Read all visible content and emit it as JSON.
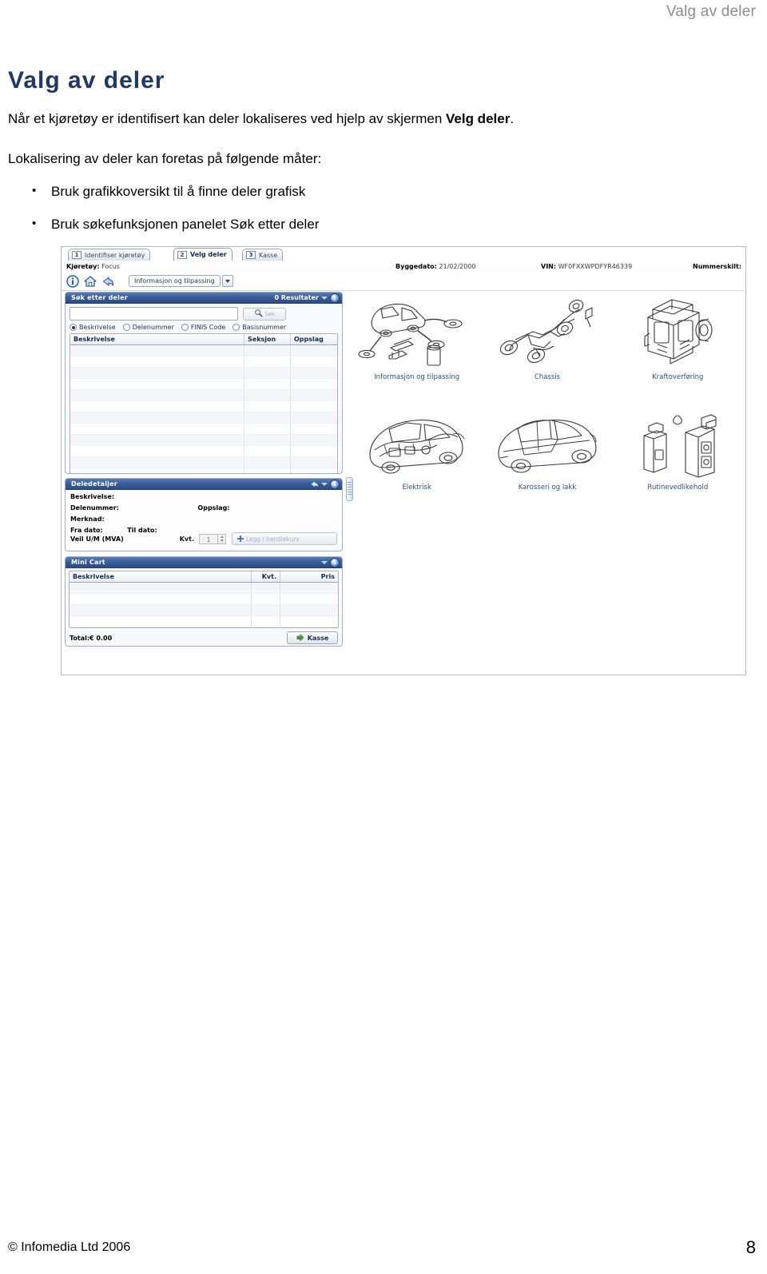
{
  "document": {
    "running_header": "Valg av deler",
    "title": "Valg av deler",
    "paragraph_1_pre": "Når et kjøretøy er identifisert kan deler lokaliseres ved hjelp av skjermen ",
    "paragraph_1_bold": "Velg deler",
    "paragraph_1_post": ".",
    "paragraph_2": "Lokalisering av deler kan foretas på følgende måter:",
    "bullets": [
      "Bruk grafikkoversikt til å finne deler grafisk",
      "Bruk søkefunksjonen panelet Søk etter deler"
    ],
    "bullet_glyph": "•",
    "footer_copyright": "© Infomedia Ltd 2006",
    "footer_page_number": "8",
    "title_color": "#1F3864",
    "header_color": "#8D8D8D"
  },
  "app": {
    "tabs": [
      {
        "number": "1",
        "label": "Identifiser kjøretøy",
        "active": false
      },
      {
        "number": "2",
        "label": "Velg deler",
        "active": true
      },
      {
        "number": "3",
        "label": "Kasse",
        "active": false
      }
    ],
    "vehicle_bar": {
      "vehicle_label": "Kjøretøy:",
      "vehicle_value": "Focus",
      "built_label": "Byggedato:",
      "built_value": "21/02/2000",
      "vin_label": "VIN:",
      "vin_value": "WF0FXXWPDFYR46339",
      "plate_label": "Nummerskilt:",
      "plate_value": ""
    },
    "toolbar": {
      "info_icon": "info-icon",
      "home_icon": "home-icon",
      "back_icon": "back-arrow-icon",
      "section_select_value": "Informasjon og tilpassing",
      "dropdown_icon": "chevron-down-icon"
    },
    "search_panel": {
      "title": "Søk etter deler",
      "results_count": "0 Resultater",
      "collapse_icon": "chevron-down-icon",
      "info_icon": "info-icon",
      "query_value": "",
      "query_placeholder": "",
      "search_button_label": "Søk",
      "search_icon": "magnifier-icon",
      "radio_options": [
        {
          "label": "Beskrivelse",
          "selected": true
        },
        {
          "label": "Delenummer",
          "selected": false
        },
        {
          "label": "FINIS Code",
          "selected": false
        },
        {
          "label": "Basisnummer",
          "selected": false
        }
      ],
      "columns": [
        "Beskrivelse",
        "Seksjon",
        "Oppslag"
      ],
      "rows": []
    },
    "detail_panel": {
      "title": "Deledetaljer",
      "back_icon": "back-arrow-icon",
      "collapse_icon": "chevron-down-icon",
      "info_icon": "info-icon",
      "fields": [
        {
          "label": "Beskrivelse:",
          "value": ""
        },
        {
          "label": "Delenummer:",
          "value": ""
        },
        {
          "label": "Oppslag:",
          "value": ""
        },
        {
          "label": "Merknad:",
          "value": ""
        },
        {
          "label": "Fra dato:",
          "value": ""
        },
        {
          "label": "Til dato:",
          "value": ""
        }
      ],
      "price_label": "Veil U/M (MVA)",
      "price_value": "",
      "qty_label": "Kvt.",
      "qty_value": "1",
      "add_to_cart_label": "Legg i handlekurv",
      "add_icon": "plus-icon"
    },
    "cart_panel": {
      "title": "Mini Cart",
      "collapse_icon": "chevron-down-icon",
      "info_icon": "info-icon",
      "columns": [
        "Beskrivelse",
        "Kvt.",
        "Pris"
      ],
      "rows": [],
      "total_label": "Total:€ 0.00",
      "checkout_label": "Kasse",
      "checkout_icon": "arrow-right-icon"
    },
    "graphics": [
      {
        "label": "Informasjon og tilpassing",
        "art": "car-with-parts"
      },
      {
        "label": "Chassis",
        "art": "chassis"
      },
      {
        "label": "Kraftoverføring",
        "art": "engine"
      },
      {
        "label": "Elektrisk",
        "art": "car-wiring"
      },
      {
        "label": "Karosseri og lakk",
        "art": "car-body"
      },
      {
        "label": "Rutinevedlikehold",
        "art": "fluid-bottles"
      }
    ],
    "splitter": "panel-splitter",
    "accent_color": "#2B4A83",
    "link_color": "#2D4F86"
  }
}
